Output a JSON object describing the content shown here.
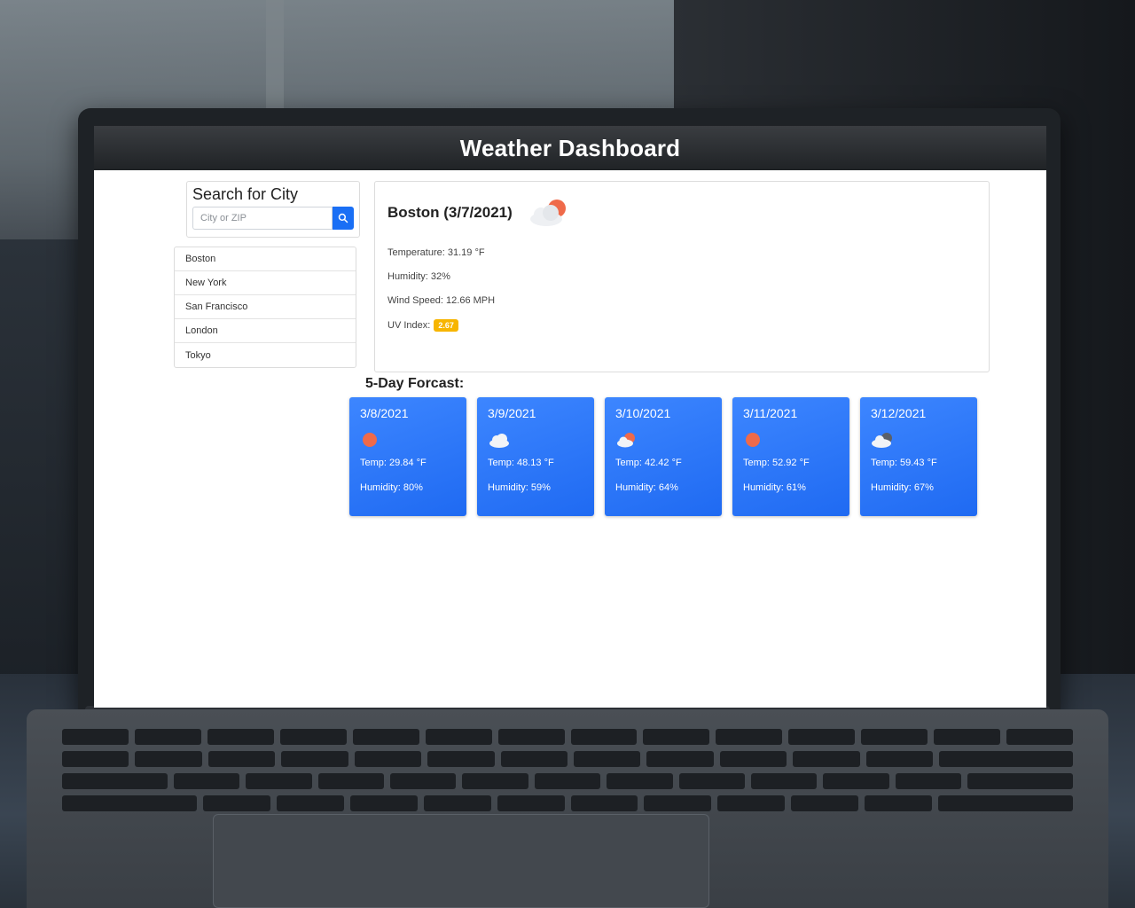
{
  "header": {
    "title": "Weather Dashboard"
  },
  "search": {
    "title": "Search for City",
    "placeholder": "City or ZIP",
    "button_icon": "search-icon"
  },
  "history": {
    "cities": [
      "Boston",
      "New York",
      "San Francisco",
      "London",
      "Tokyo"
    ]
  },
  "current": {
    "title": "Boston (3/7/2021)",
    "icon": "partly-cloudy-icon",
    "temperature": "Temperature: 31.19 °F",
    "humidity": "Humidity: 32%",
    "wind": "Wind Speed: 12.66 MPH",
    "uv_label": "UV Index:",
    "uv_value": "2.67",
    "uv_color": "#f7b500"
  },
  "forecast": {
    "title": "5-Day Forcast:",
    "days": [
      {
        "date": "3/8/2021",
        "icon": "sun-icon",
        "temp": "Temp: 29.84 °F",
        "humidity": "Humidity: 80%"
      },
      {
        "date": "3/9/2021",
        "icon": "cloud-icon",
        "temp": "Temp: 48.13 °F",
        "humidity": "Humidity: 59%"
      },
      {
        "date": "3/10/2021",
        "icon": "partly-cloudy-icon",
        "temp": "Temp: 42.42 °F",
        "humidity": "Humidity: 64%"
      },
      {
        "date": "3/11/2021",
        "icon": "sun-icon",
        "temp": "Temp: 52.92 °F",
        "humidity": "Humidity: 61%"
      },
      {
        "date": "3/12/2021",
        "icon": "dark-cloud-icon",
        "temp": "Temp: 59.43 °F",
        "humidity": "Humidity: 67%"
      }
    ],
    "card_color": "#2a74f7"
  },
  "colors": {
    "header_bg": "#2a2d31",
    "accent": "#1a6ff5"
  }
}
